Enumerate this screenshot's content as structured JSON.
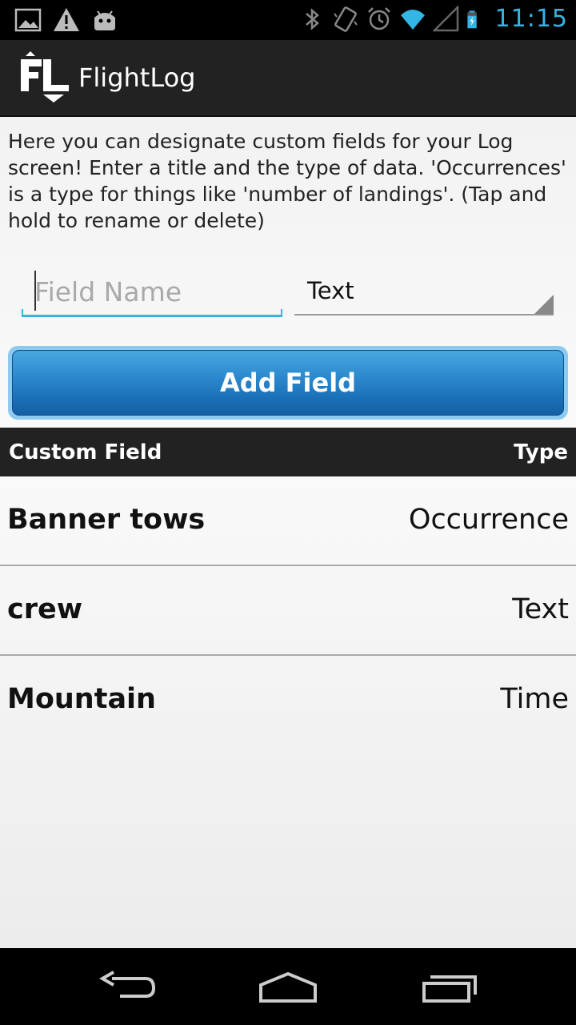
{
  "status_bar": {
    "time": "11:15",
    "icons": [
      "image-icon",
      "warning-icon",
      "android-icon",
      "bluetooth-icon",
      "vibrate-icon",
      "alarm-icon",
      "wifi-icon",
      "signal-icon",
      "battery-charging-icon"
    ]
  },
  "action_bar": {
    "logo": "FL",
    "title": "FlightLog"
  },
  "intro_text": "Here you can designate custom fields for your Log screen! Enter a title and the type of data. 'Occurrences' is a type for things like 'number of landings'. (Tap and hold to rename or delete)",
  "form": {
    "field_name_placeholder": "Field Name",
    "field_name_value": "",
    "type_selected": "Text",
    "add_button_label": "Add Field"
  },
  "table": {
    "header_field": "Custom Field",
    "header_type": "Type",
    "rows": [
      {
        "name": "Banner tows",
        "type": "Occurrence"
      },
      {
        "name": "crew",
        "type": "Text"
      },
      {
        "name": "Mountain",
        "type": "Time"
      }
    ]
  },
  "colors": {
    "accent": "#33b5e5",
    "action_bar": "#222222",
    "button_blue": "#1a6fb6"
  }
}
